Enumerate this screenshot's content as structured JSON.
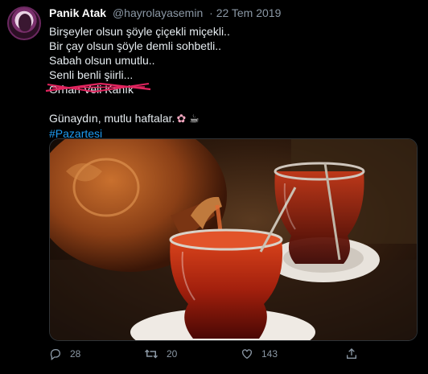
{
  "tweet": {
    "display_name": "Panik Atak",
    "handle": "@hayrolayasemin",
    "dot": "·",
    "date": "22 Tem 2019",
    "lines": [
      "Birşeyler olsun şöyle çiçekli miçekli..",
      "Bir çay olsun şöyle demli sohbetli..",
      "Sabah olsun umutlu..",
      "Senli benli şiirli..."
    ],
    "struck_line": "Orhan Veli Kanık",
    "greeting": "Günaydın, mutlu haftalar.",
    "greeting_emojis": [
      "cherry-blossom",
      "hot-beverage"
    ],
    "hashtag": "#Pazartesi"
  },
  "actions": {
    "replies": "28",
    "retweets": "20",
    "likes": "143"
  },
  "colors": {
    "background": "#000000",
    "link": "#1d9bf0",
    "muted": "#8b98a5",
    "strike": "#e0245e"
  }
}
